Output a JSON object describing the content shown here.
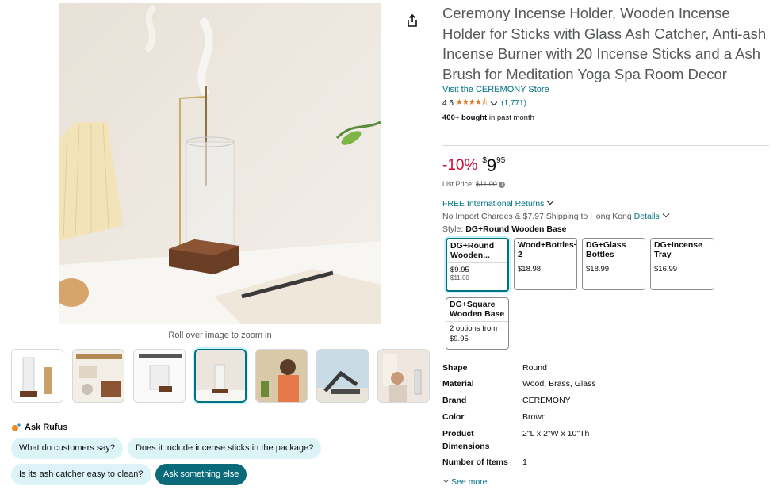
{
  "product": {
    "title": "Ceremony Incense Holder, Wooden Incense Holder for Sticks with Glass Ash Catcher, Anti-ash Incense Burner with 20 Incense Sticks and a Ash Brush for Meditation Yoga Spa Room Decor",
    "store_link": "Visit the CEREMONY Store",
    "rating": "4.5",
    "stars": "★★★★⯪",
    "rating_count": "(1,771)",
    "bought_bold": "400+ bought",
    "bought_rest": " in past month"
  },
  "price": {
    "discount": "-10%",
    "currency": "$",
    "whole": "9",
    "fraction": "95",
    "list_label": "List Price: ",
    "list_value": "$11.00",
    "info_icon": "i"
  },
  "shipping": {
    "free_returns": "FREE International Returns",
    "import_text": "No Import Charges & $7.97 Shipping to Hong Kong ",
    "details": "Details"
  },
  "style": {
    "label": "Style: ",
    "selected": "DG+Round Wooden Base",
    "options": [
      {
        "name": "DG+Round Wooden...",
        "price": "$9.95",
        "strike": "$11.00"
      },
      {
        "name": "Wood+Bottles+Square 2",
        "price": "$18.98",
        "strike": ""
      },
      {
        "name": "DG+Glass Bottles",
        "price": "$18.99",
        "strike": ""
      },
      {
        "name": "DG+Incense Tray",
        "price": "$16.99",
        "strike": ""
      },
      {
        "name": "DG+Square Wooden Base",
        "price": "2 options from",
        "strike2": "$9.95"
      }
    ]
  },
  "specs": [
    {
      "key": "Shape",
      "value": "Round"
    },
    {
      "key": "Material",
      "value": "Wood, Brass, Glass"
    },
    {
      "key": "Brand",
      "value": "CEREMONY"
    },
    {
      "key": "Color",
      "value": "Brown"
    },
    {
      "key": "Product Dimensions",
      "value": "2\"L x 2\"W x 10\"Th"
    },
    {
      "key": "Number of Items",
      "value": "1"
    }
  ],
  "see_more": "See more",
  "gallery": {
    "zoom_hint": "Roll over image to zoom in"
  },
  "rufus": {
    "title": "Ask Rufus",
    "chips": [
      "What do customers say?",
      "Does it include incense sticks in the package?",
      "Is its ash catcher easy to clean?",
      "Ask something else"
    ]
  },
  "colors": {
    "accent": "#007185",
    "discount": "#cc0c39",
    "star": "#de7921",
    "chip": "#dcf3f8",
    "chip_dark": "#0b6a7a"
  }
}
